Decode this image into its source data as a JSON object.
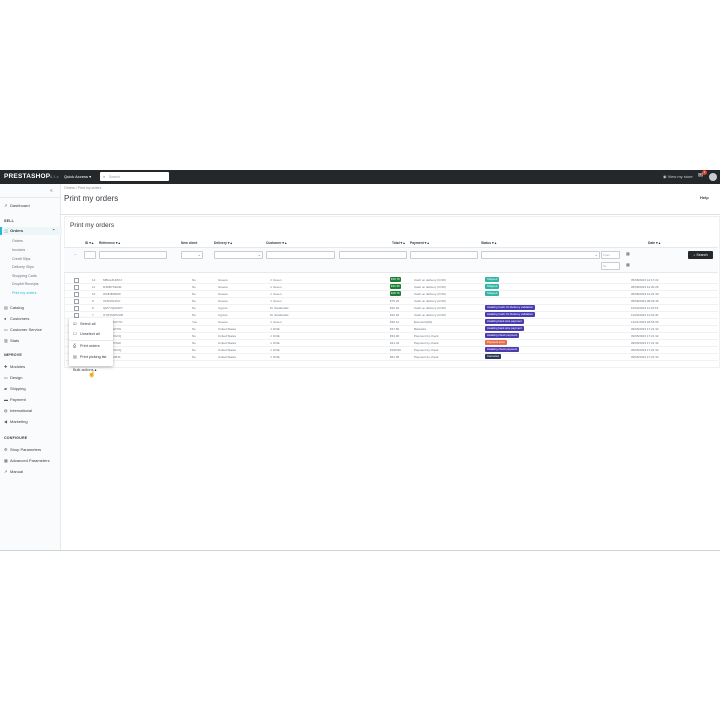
{
  "topbar": {
    "logo": "PRESTASHOP",
    "version": "8.1.x",
    "quick_access": "Quick Access ▾",
    "search_placeholder": "Search",
    "view_shop": "View my store",
    "notifications_count": "1"
  },
  "sidebar": {
    "dashboard": "Dashboard",
    "sell_heading": "SELL",
    "orders": "Orders",
    "orders_sub": [
      "Orders",
      "Invoices",
      "Credit Slips",
      "Delivery Slips",
      "Shopping Carts",
      "Dropbit Receipts",
      "Print my orders"
    ],
    "catalog": "Catalog",
    "customers": "Customers",
    "customer_service": "Customer Service",
    "stats": "Stats",
    "improve_heading": "IMPROVE",
    "modules": "Modules",
    "design": "Design",
    "shipping": "Shipping",
    "payment": "Payment",
    "international": "International",
    "marketing": "Marketing",
    "configure_heading": "CONFIGURE",
    "shop_parameters": "Shop Parameters",
    "advanced_parameters": "Advanced Parameters",
    "manual": "Manual"
  },
  "main": {
    "breadcrumb": "Orders  /  Print my orders",
    "title": "Print my orders",
    "help": "Help",
    "panel_title": "Print my orders"
  },
  "table": {
    "headers": [
      "ID ▾ ▴",
      "Reference ▾ ▴",
      "New client",
      "Delivery ▾ ▴",
      "Customer ▾ ▴",
      "Total ▾ ▴",
      "Payment ▾ ▴",
      "Status ▾ ▴",
      "Date ▾ ▴"
    ],
    "filter": {
      "date_from": "From",
      "date_to": "To",
      "search_label": "Search"
    },
    "rows": [
      {
        "id": "12",
        "ref": "MBGLZUMOJ",
        "new": "No",
        "delivery": "Greece",
        "customer": "J. Green",
        "total": "€39.78",
        "total_badge": true,
        "payment": "Cash on delivery (COD)",
        "status": "Shipped",
        "status_color": "#2fb5a3",
        "date": "05/08/2023 12:17:22"
      },
      {
        "id": "11",
        "ref": "DJRBYKEAM",
        "new": "No",
        "delivery": "Greece",
        "customer": "J. Green",
        "total": "€22.35",
        "total_badge": true,
        "payment": "Cash on delivery (COD)",
        "status": "Shipped",
        "status_color": "#2fb5a3",
        "date": "05/08/2023 12:20:26"
      },
      {
        "id": "10",
        "ref": "WAIDBNDIW",
        "new": "No",
        "delivery": "Greece",
        "customer": "J. Green",
        "total": "€28.76",
        "total_badge": true,
        "payment": "Cash on delivery (COD)",
        "status": "Shipped",
        "status_color": "#2fb5a3",
        "date": "05/08/2023 12:21:30"
      },
      {
        "id": "9",
        "ref": "XFRIJWJGO",
        "new": "No",
        "delivery": "Greece",
        "customer": "J. Green",
        "total": "€75.23",
        "total_badge": false,
        "payment": "Cash on delivery (COD)",
        "status": "",
        "status_color": "",
        "date": "05/08/2023 09:03:46"
      },
      {
        "id": "8",
        "ref": "QMYVQGMZY",
        "new": "No",
        "delivery": "Cyprus",
        "customer": "M. Sarafoudis",
        "total": "€22.63",
        "total_badge": false,
        "payment": "Cash on delivery (COD)",
        "status": "Awaiting Cash On Delivery validation",
        "status_color": "#4a3bb0",
        "date": "12/02/2023 11:15:16"
      },
      {
        "id": "7",
        "ref": "UYRXMWUAB",
        "new": "No",
        "delivery": "Cyprus",
        "customer": "M. Sarafoudis",
        "total": "€22.63",
        "total_badge": false,
        "payment": "Cash on delivery (COD)",
        "status": "Awaiting Cash On Delivery validation",
        "status_color": "#4a3bb0",
        "date": "12/02/2023 11:04:40"
      },
      {
        "id": "6",
        "ref": "KHWSRUFTO",
        "new": "Yes",
        "delivery": "Greece",
        "customer": "J. Green",
        "total": "€36.12",
        "total_badge": false,
        "payment": "Economic[bit]",
        "status": "Awaiting bank wire payment",
        "status_color": "#4a3bb0",
        "date": "12/01/2023 18:54:06"
      },
      {
        "id": "5",
        "ref": "FFATFGPXW",
        "new": "No",
        "delivery": "United States",
        "customer": "J. DOE",
        "total": "€37.50",
        "total_badge": false,
        "payment": "Bankwire",
        "status": "Awaiting bank wire payment",
        "status_color": "#4a3bb0",
        "date": "09/05/2023 17:21:32"
      },
      {
        "id": "4",
        "ref": "FFATNOGVQ",
        "new": "No",
        "delivery": "United States",
        "customer": "J. DOE",
        "total": "€33.00",
        "total_badge": false,
        "payment": "Payment by check",
        "status": "Awaiting check payment",
        "status_color": "#4a3bb0",
        "date": "09/05/2023 17:21:32"
      },
      {
        "id": "3",
        "ref": "UOYEVOSHI",
        "new": "No",
        "delivery": "United States",
        "customer": "J. DOE",
        "total": "€41.34",
        "total_badge": false,
        "payment": "Payment by check",
        "status": "Payment error",
        "status_color": "#e86e50",
        "date": "09/05/2023 17:21:32"
      },
      {
        "id": "2",
        "ref": "FFATNOGVQ",
        "new": "No",
        "delivery": "United States",
        "customer": "J. DOE",
        "total": "€169.90",
        "total_badge": false,
        "payment": "Payment by check",
        "status": "Awaiting check payment",
        "status_color": "#4a3bb0",
        "date": "09/05/2023 17:21:32"
      },
      {
        "id": "1",
        "ref": "XKBKNABJK",
        "new": "No",
        "delivery": "United States",
        "customer": "J. DOE",
        "total": "€61.05",
        "total_badge": false,
        "payment": "Payment by check",
        "status": "Canceled",
        "status_color": "#2c3a5a",
        "date": "09/05/2023 17:21:32"
      }
    ]
  },
  "bulk": {
    "button": "Bulk actions ▴",
    "items": [
      "Select all",
      "Unselect all",
      "Print orders",
      "Print picking list"
    ]
  }
}
